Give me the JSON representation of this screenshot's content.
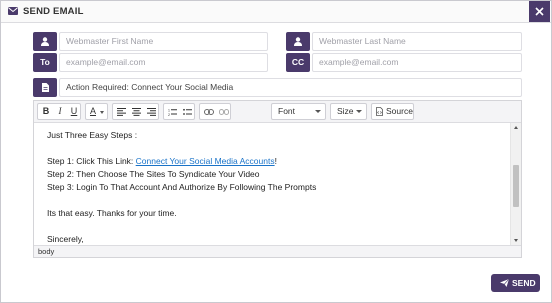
{
  "dialog": {
    "title": "SEND EMAIL",
    "title_icon": "envelope-icon",
    "close_icon": "close-icon"
  },
  "form": {
    "first_name": {
      "icon": "user-icon",
      "placeholder": "Webmaster First Name"
    },
    "last_name": {
      "icon": "user-icon",
      "placeholder": "Webmaster Last Name"
    },
    "to": {
      "label": "To",
      "placeholder": "example@email.com"
    },
    "cc": {
      "label": "CC",
      "placeholder": "example@email.com"
    },
    "subject": {
      "icon": "document-icon",
      "value": "Action Required: Connect Your Social Media"
    }
  },
  "toolbar": {
    "bold": "B",
    "italic": "I",
    "underline": "U",
    "font_color": "A",
    "font_select": "Font",
    "size_select": "Size",
    "source": "Source"
  },
  "editor": {
    "lines": {
      "intro": "Just Three Easy Steps :",
      "step1_prefix": "Step 1: Click This Link: ",
      "step1_link": "Connect Your Social Media Accounts",
      "step1_suffix": "!",
      "step2": "Step 2: Then Choose The Sites To Syndicate Your Video",
      "step3": "Step 3: Login To That Account And Authorize By Following The Prompts",
      "easy": "Its that easy. Thanks for your time.",
      "closing": "Sincerely,"
    },
    "status_path": "body"
  },
  "actions": {
    "send_label": "SEND",
    "send_icon": "paper-plane-icon"
  },
  "colors": {
    "accent": "#4a3a6b",
    "link": "#1a73c8"
  }
}
